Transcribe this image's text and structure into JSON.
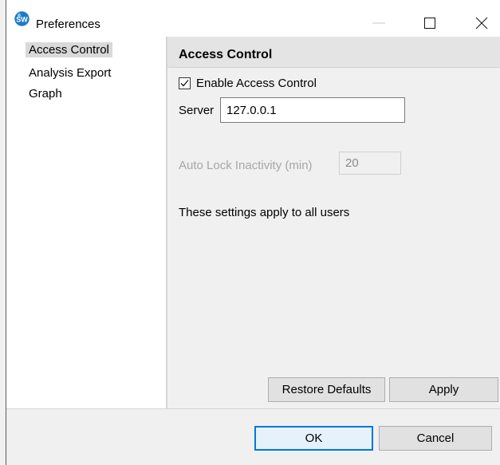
{
  "window": {
    "title": "Preferences",
    "app_icon": "sw-logo-icon",
    "controls": {
      "minimize": "minimize-icon",
      "maximize": "maximize-icon",
      "close": "close-icon"
    }
  },
  "nav": {
    "items": [
      {
        "label": "Access Control",
        "selected": true
      },
      {
        "label": "Analysis Export",
        "selected": false
      },
      {
        "label": "Graph",
        "selected": false
      }
    ]
  },
  "page": {
    "title": "Access Control",
    "enable_label": "Enable Access Control",
    "enable_checked": true,
    "server_label": "Server",
    "server_value": "127.0.0.1",
    "autolock_label": "Auto Lock Inactivity (min)",
    "autolock_value": "20",
    "autolock_disabled": true,
    "note": "These settings apply to all users",
    "restore_label": "Restore Defaults",
    "apply_label": "Apply"
  },
  "footer": {
    "ok_label": "OK",
    "cancel_label": "Cancel"
  },
  "colors": {
    "accent": "#0078d7",
    "logo": "#1a7bc9",
    "disabled_text": "#a6a6a6"
  }
}
